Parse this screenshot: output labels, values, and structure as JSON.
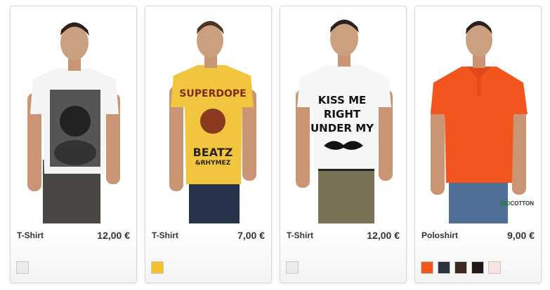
{
  "products": [
    {
      "name": "T-Shirt",
      "price": "12,00 €",
      "shirt_color": "#f4f4f2",
      "swatches": [
        "#ebebeb"
      ]
    },
    {
      "name": "T-Shirt",
      "price": "7,00 €",
      "shirt_color": "#f1c53d",
      "shirt_print_lines": [
        "SUPERDOPE",
        "BEATZ",
        "&RHYMEZ"
      ],
      "swatches": [
        "#f3c230"
      ]
    },
    {
      "name": "T-Shirt",
      "price": "12,00 €",
      "shirt_color": "#f6f6f6",
      "shirt_print_lines": [
        "KISS ME",
        "RIGHT",
        "UNDER MY"
      ],
      "swatches": [
        "#ebebeb"
      ]
    },
    {
      "name": "Poloshirt",
      "price": "9,00 €",
      "shirt_color": "#f2551e",
      "badge": {
        "bio": "BIO",
        "cotton": "COTTON"
      },
      "swatches": [
        "#f2551e",
        "#2b3240",
        "#3e2a24",
        "#1f1a18",
        "#f8e2e2"
      ]
    }
  ]
}
